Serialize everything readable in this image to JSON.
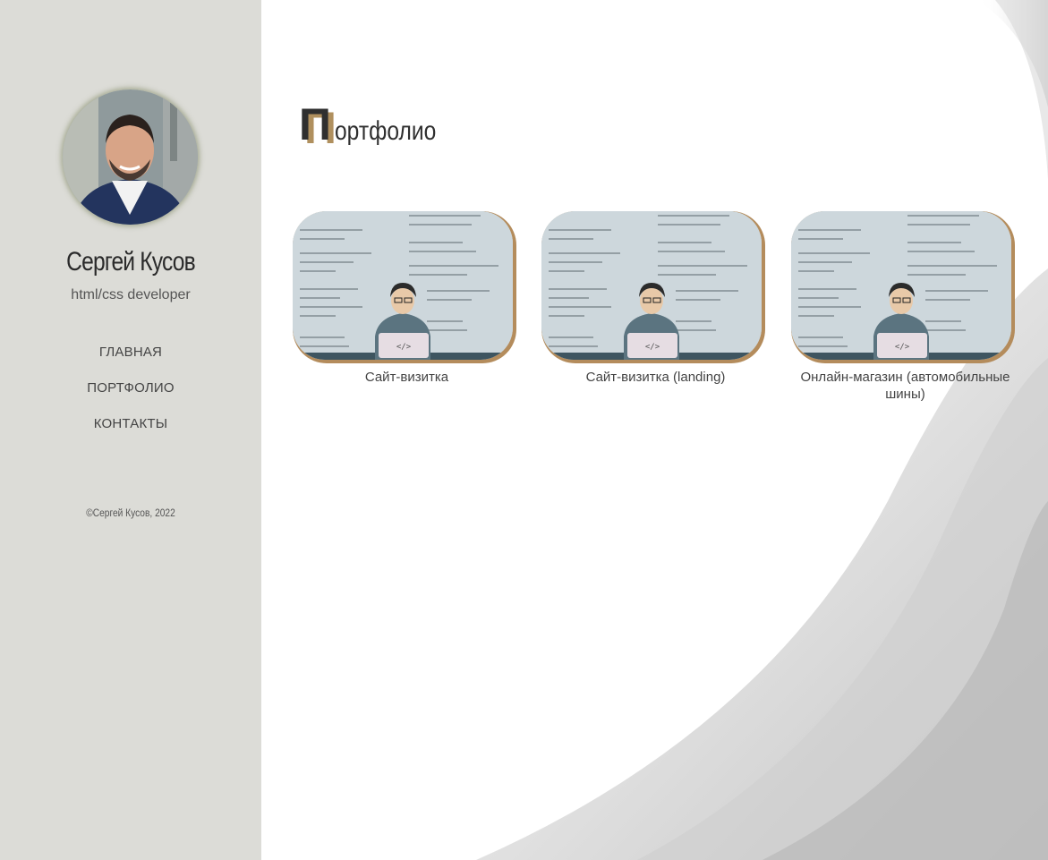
{
  "sidebar": {
    "name": "Сергей Кусов",
    "role": "html/css developer",
    "nav": [
      {
        "label": "ГЛАВНАЯ"
      },
      {
        "label": "ПОРТФОЛИО"
      },
      {
        "label": "КОНТАКТЫ"
      }
    ],
    "copyright": "©Сергей Кусов, 2022"
  },
  "main": {
    "title_cap": "П",
    "title_rest": "ортфолио",
    "cards": [
      {
        "caption": "Сайт-визитка",
        "thumb_label": "</>"
      },
      {
        "caption": "Сайт-визитка (landing)",
        "thumb_label": "</>"
      },
      {
        "caption": "Онлайн-магазин (автомобильные шины)",
        "thumb_label": "</>"
      }
    ]
  },
  "colors": {
    "sidebar_bg": "#dcdcd7",
    "accent": "#b0905e",
    "text_dark": "#2f2f2f"
  }
}
